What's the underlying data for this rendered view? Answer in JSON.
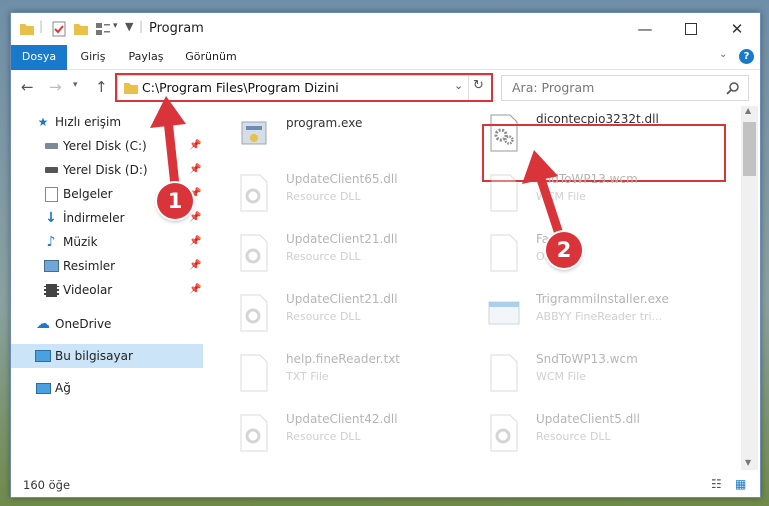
{
  "window": {
    "title": "Program"
  },
  "ribbon": {
    "tabs": [
      "Dosya",
      "Giriş",
      "Paylaş",
      "Görünüm"
    ],
    "help_label": "?"
  },
  "nav": {
    "address": "C:\\Program Files\\Program Dizini",
    "search_placeholder": "Ara: Program"
  },
  "sidebar": {
    "items": [
      {
        "label": "Hızlı erişim",
        "icon": "star-icon"
      },
      {
        "label": "Yerel Disk (C:)",
        "icon": "drive-icon",
        "pinned": true
      },
      {
        "label": "Yerel Disk (D:)",
        "icon": "drive-icon",
        "pinned": true
      },
      {
        "label": "Belgeler",
        "icon": "documents-icon",
        "pinned": true
      },
      {
        "label": "İndirmeler",
        "icon": "download-icon",
        "pinned": true
      },
      {
        "label": "Müzik",
        "icon": "music-icon",
        "pinned": true
      },
      {
        "label": "Resimler",
        "icon": "pictures-icon",
        "pinned": true
      },
      {
        "label": "Videolar",
        "icon": "video-icon",
        "pinned": true
      },
      {
        "label": "OneDrive",
        "icon": "cloud-icon"
      },
      {
        "label": "Bu bilgisayar",
        "icon": "computer-icon",
        "selected": true
      },
      {
        "label": "Ağ",
        "icon": "network-icon"
      }
    ]
  },
  "files": [
    {
      "name": "program.exe",
      "type": ""
    },
    {
      "name": "dicontecpio3232t.dll",
      "type": ""
    },
    {
      "name": "UpdateClient65.dll",
      "type": "Resource DLL"
    },
    {
      "name": "SndToWP13.wcm",
      "type": "WCM File"
    },
    {
      "name": "UpdateClient21.dll",
      "type": "Resource DLL"
    },
    {
      "name": "Fast...k",
      "type": "OK..."
    },
    {
      "name": "UpdateClient21.dll",
      "type": "Resource DLL"
    },
    {
      "name": "TrigrammiInstaller.exe",
      "type": "ABBYY FineReader tri..."
    },
    {
      "name": "help.fineReader.txt",
      "type": "TXT File"
    },
    {
      "name": "SndToWP13.wcm",
      "type": "WCM File"
    },
    {
      "name": "UpdateClient42.dll",
      "type": "Resource DLL"
    },
    {
      "name": "UpdateClient5.dll",
      "type": "Resource DLL"
    }
  ],
  "status": {
    "count": "160 öğe"
  },
  "annotations": {
    "step1": "1",
    "step2": "2",
    "highlight_color": "#d9343a"
  }
}
